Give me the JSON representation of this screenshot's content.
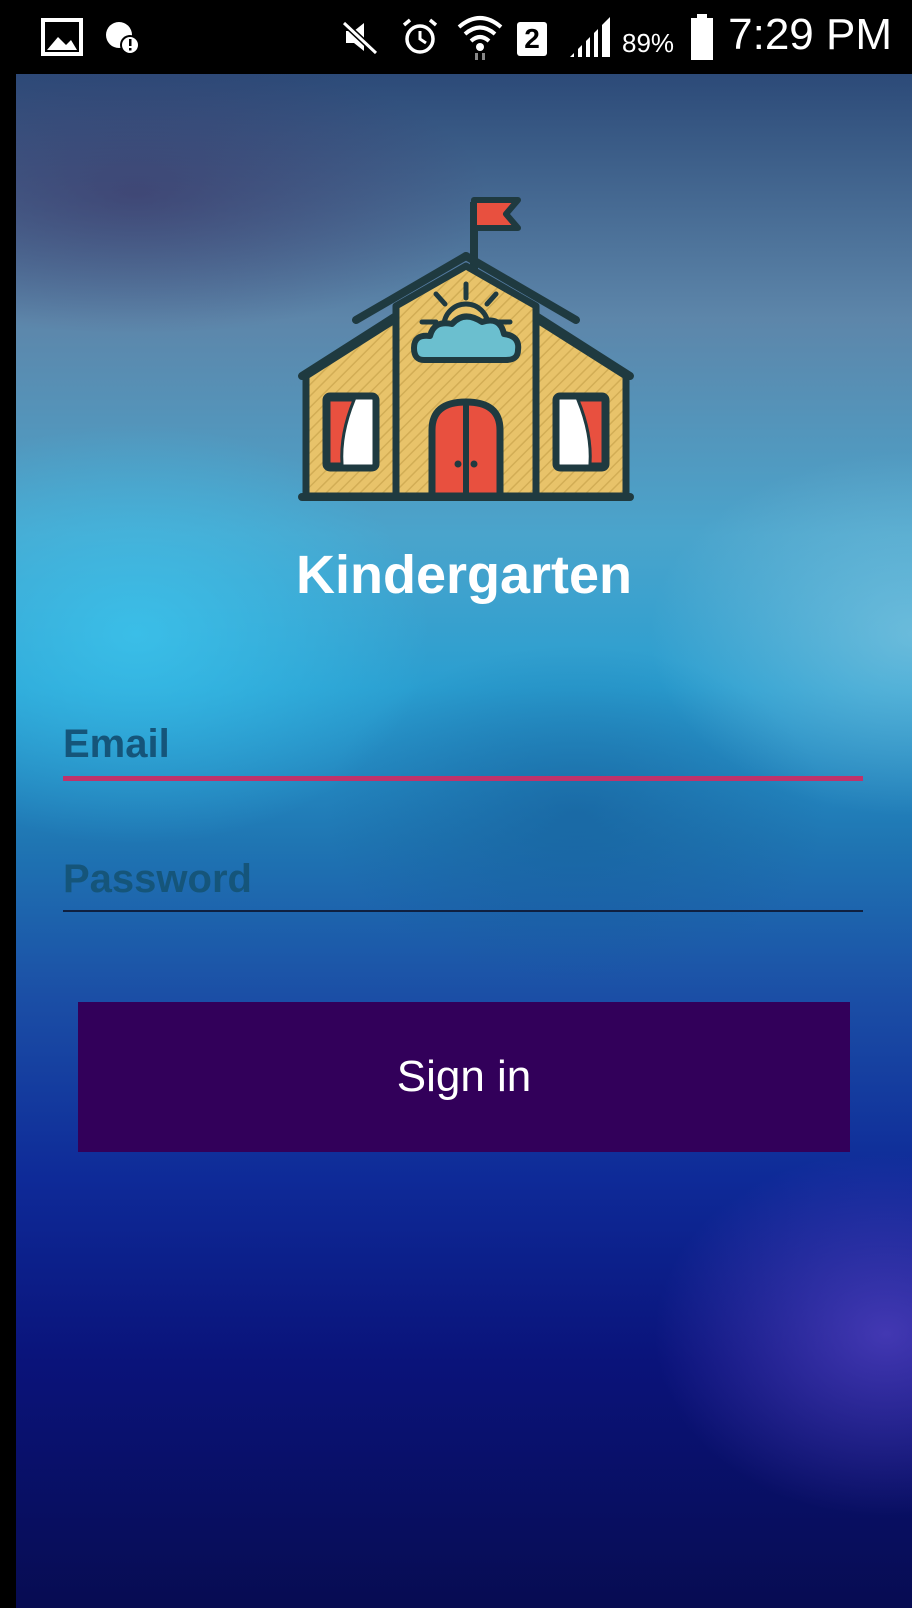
{
  "status_bar": {
    "time": "7:29 PM",
    "battery_percent": "89%",
    "sim_slot": "2",
    "icons": [
      "gallery-icon",
      "notification-alert-icon",
      "mute-icon",
      "alarm-icon",
      "wifi-icon",
      "sim-2-icon",
      "signal-icon",
      "battery-icon"
    ]
  },
  "app": {
    "title": "Kindergarten",
    "logo_icon": "school-house-icon"
  },
  "login_form": {
    "email_label": "Email",
    "password_label": "Password",
    "sign_in_label": "Sign in",
    "accent_color": "#c0326a",
    "button_color": "#32005a"
  }
}
